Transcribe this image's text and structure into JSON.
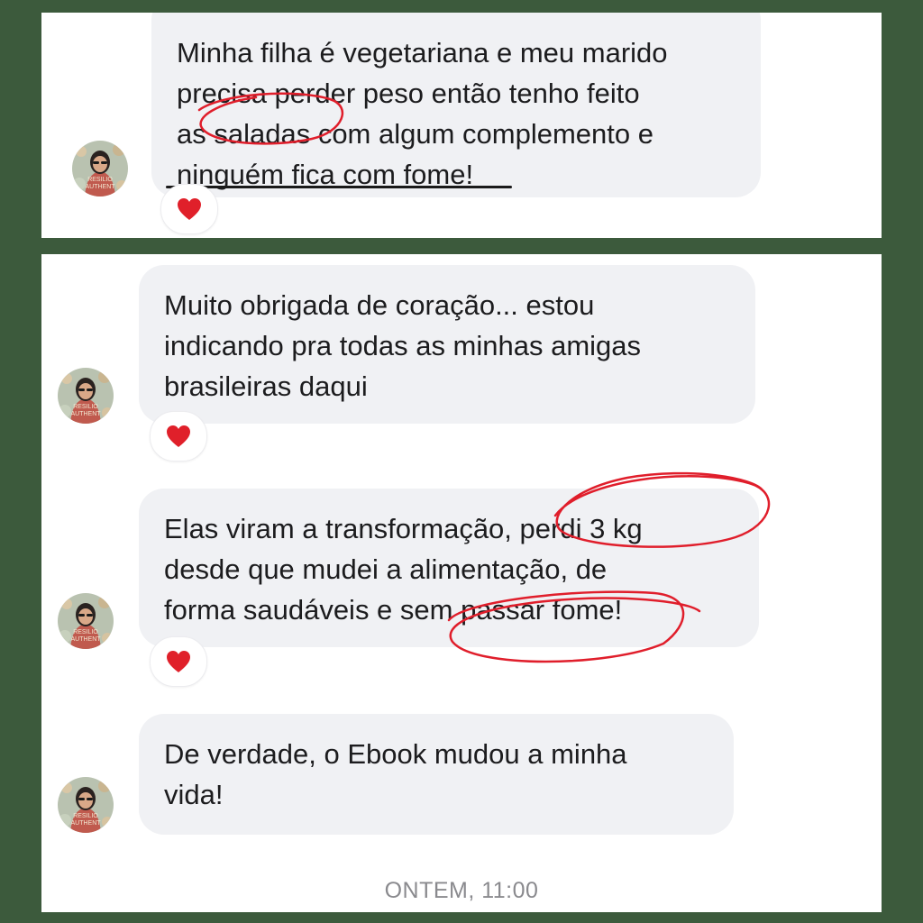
{
  "messages": [
    {
      "lines": [
        "Minha filha é vegetariana e meu marido",
        "precisa perder peso então tenho feito",
        "as saladas com algum complemento e",
        "ninguém fica com fome!"
      ],
      "reaction": "heart"
    },
    {
      "lines": [
        "Muito obrigada de coração... estou",
        "indicando pra todas as minhas amigas",
        "brasileiras daqui"
      ],
      "reaction": "heart"
    },
    {
      "lines": [
        "Elas viram a transformação, perdi 3 kg",
        "desde que mudei a alimentação, de",
        "forma saudáveis e sem passar fome!"
      ],
      "reaction": "heart"
    },
    {
      "lines": [
        "De verdade, o Ebook mudou a minha",
        "vida!"
      ]
    }
  ],
  "timestamp": "ONTEM, 11:00",
  "colors": {
    "background": "#3c5a3c",
    "bubble": "#f0f1f4",
    "heart": "#e0202a",
    "annotation": "#e01e2b"
  },
  "icons": {
    "reaction": "heart-icon",
    "avatar": "avatar"
  }
}
